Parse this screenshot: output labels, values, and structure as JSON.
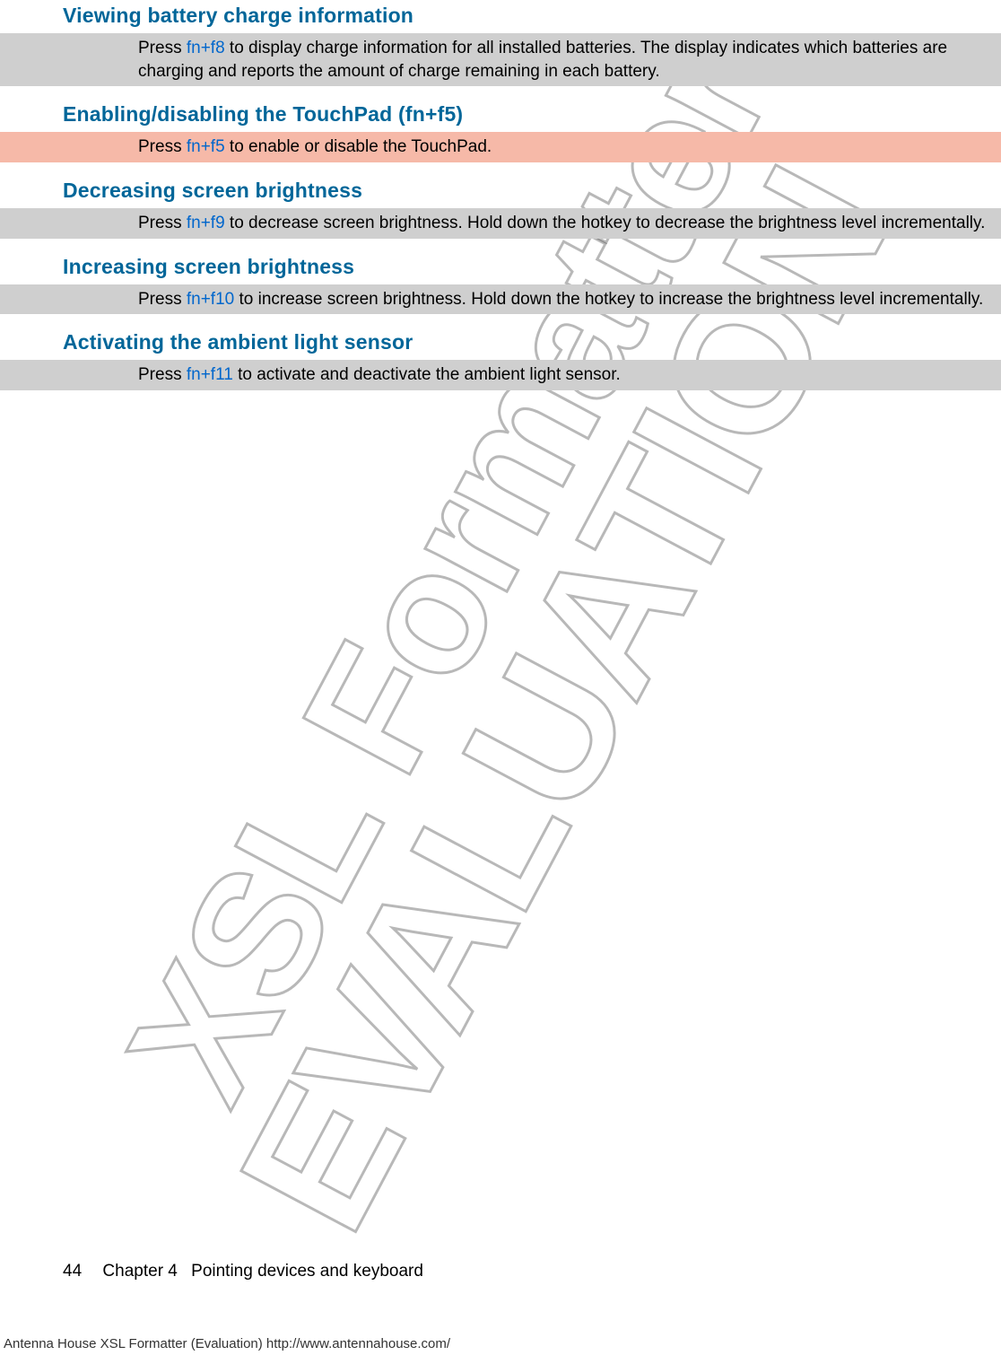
{
  "watermarks": {
    "line1": "XSL Formatter",
    "line2": "EVALUATION"
  },
  "sections": [
    {
      "heading": "Viewing battery charge information",
      "highlight": false,
      "body_pre": "Press ",
      "hotkey": "fn+f8",
      "body_post": " to display charge information for all installed batteries. The display indicates which batteries are charging and reports the amount of charge remaining in each battery."
    },
    {
      "heading": "Enabling/disabling the TouchPad (fn+f5)",
      "highlight": true,
      "body_pre": "Press ",
      "hotkey": "fn+f5",
      "body_post": " to enable or disable the TouchPad."
    },
    {
      "heading": "Decreasing screen brightness",
      "highlight": false,
      "body_pre": "Press ",
      "hotkey": "fn+f9",
      "body_post": " to decrease screen brightness. Hold down the hotkey to decrease the brightness level incrementally."
    },
    {
      "heading": "Increasing screen brightness",
      "highlight": false,
      "body_pre": "Press ",
      "hotkey": "fn+f10",
      "body_post": " to increase screen brightness. Hold down the hotkey to increase the brightness level incrementally."
    },
    {
      "heading": "Activating the ambient light sensor",
      "highlight": false,
      "body_pre": "Press ",
      "hotkey": "fn+f11",
      "body_post": " to activate and deactivate the ambient light sensor."
    }
  ],
  "footer": {
    "page_number": "44",
    "chapter_label": "Chapter 4",
    "chapter_title": "Pointing devices and keyboard",
    "eval_text": "Antenna House XSL Formatter (Evaluation)  http://www.antennahouse.com/"
  }
}
